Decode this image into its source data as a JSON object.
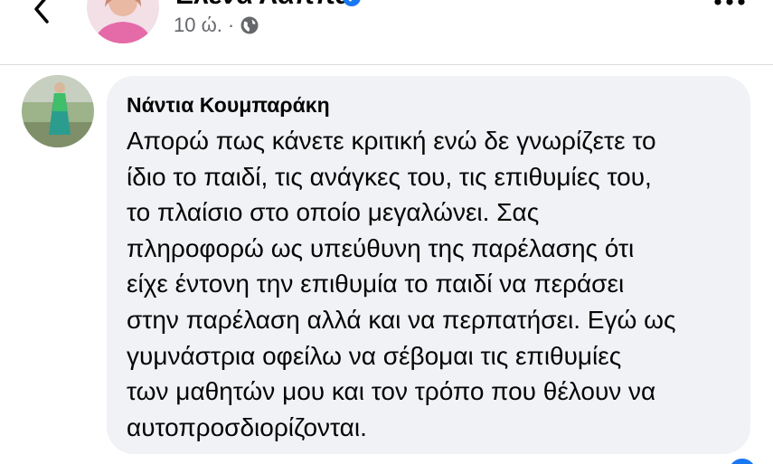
{
  "post_header": {
    "author_name": "Ελένα Λάππα",
    "time": "10 ώ.",
    "separator": "·",
    "privacy_icon": "globe-icon",
    "verified_icon": "verified-badge-icon",
    "back_icon": "chevron-left-icon",
    "more_icon": "more-dots-icon"
  },
  "comment": {
    "author": "Νάντια Κουμπαράκη",
    "lines": [
      "Απορώ πως κάνετε κριτική ενώ δε γνωρίζετε το",
      "ίδιο το παιδί, τις ανάγκες του, τις επιθυμίες του,",
      "το πλαίσιο στο οποίο μεγαλώνει. Σας",
      "πληροφορώ ως υπεύθυνη της παρέλασης ότι",
      "είχε έντονη την επιθυμία το παιδί να περάσει",
      "στην παρέλαση αλλά και να περπατήσει. Εγώ ως",
      "γυμνάστρια οφείλω να σέβομαι τις επιθυμίες",
      "των μαθητών μου και τον τρόπο που θέλουν να",
      "αυτοπροσδιορίζονται."
    ]
  },
  "colors": {
    "bubble_bg": "#f0f2f5",
    "text": "#050505",
    "meta_text": "#65676b",
    "accent": "#1877f2"
  }
}
